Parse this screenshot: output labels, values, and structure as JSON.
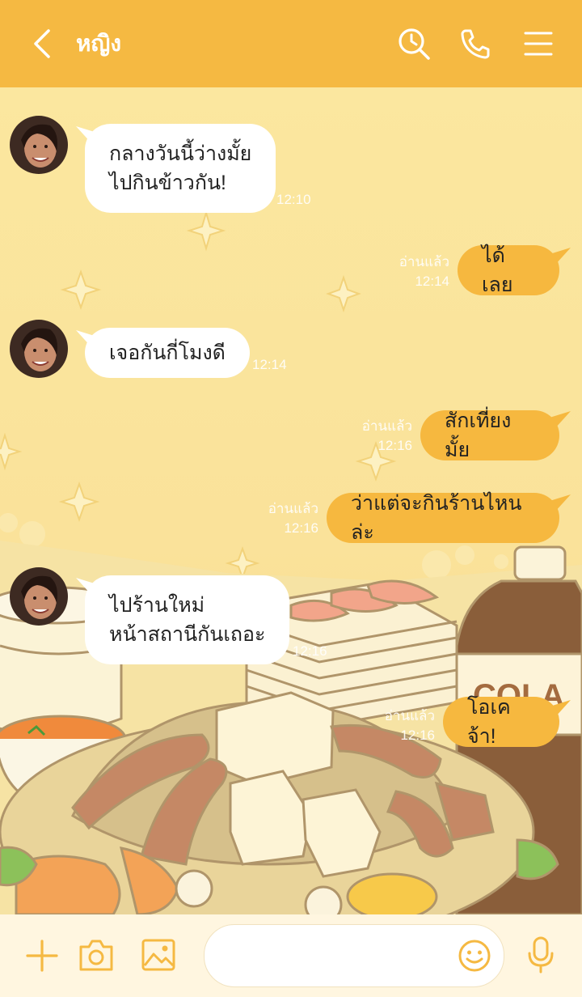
{
  "header": {
    "title": "หญิง",
    "icons": [
      "back-arrow-icon",
      "search-history-icon",
      "phone-icon",
      "menu-icon"
    ]
  },
  "messages": [
    {
      "side": "in",
      "lines": [
        "กลางวันนี้ว่างมั้ย",
        "ไปกินข้าวกัน!"
      ],
      "time": "12:10"
    },
    {
      "side": "out",
      "lines": [
        "ได้เลย"
      ],
      "read": "อ่านแล้ว",
      "time": "12:14"
    },
    {
      "side": "in",
      "lines": [
        "เจอกันกี่โมงดี"
      ],
      "time": "12:14"
    },
    {
      "side": "out",
      "lines": [
        "สักเที่ยงมั้ย"
      ],
      "read": "อ่านแล้ว",
      "time": "12:16"
    },
    {
      "side": "out",
      "lines": [
        "ว่าแต่จะกินร้านไหนล่ะ"
      ],
      "read": "อ่านแล้ว",
      "time": "12:16"
    },
    {
      "side": "in",
      "lines": [
        "ไปร้านใหม่",
        "หน้าสถานีกันเถอะ"
      ],
      "time": "12:16"
    },
    {
      "side": "out",
      "lines": [
        "โอเคจ้า!"
      ],
      "read": "อ่านแล้ว",
      "time": "12:16"
    }
  ],
  "background": {
    "bottle_label": "COLA"
  },
  "bottom_bar": {
    "icons": [
      "plus-icon",
      "camera-icon",
      "image-icon",
      "emoji-icon",
      "microphone-icon"
    ],
    "input_placeholder": ""
  },
  "colors": {
    "header": "#f5b942",
    "outgoing_bubble": "#f6b83f",
    "incoming_bubble": "#ffffff",
    "icon": "#f5b942"
  }
}
